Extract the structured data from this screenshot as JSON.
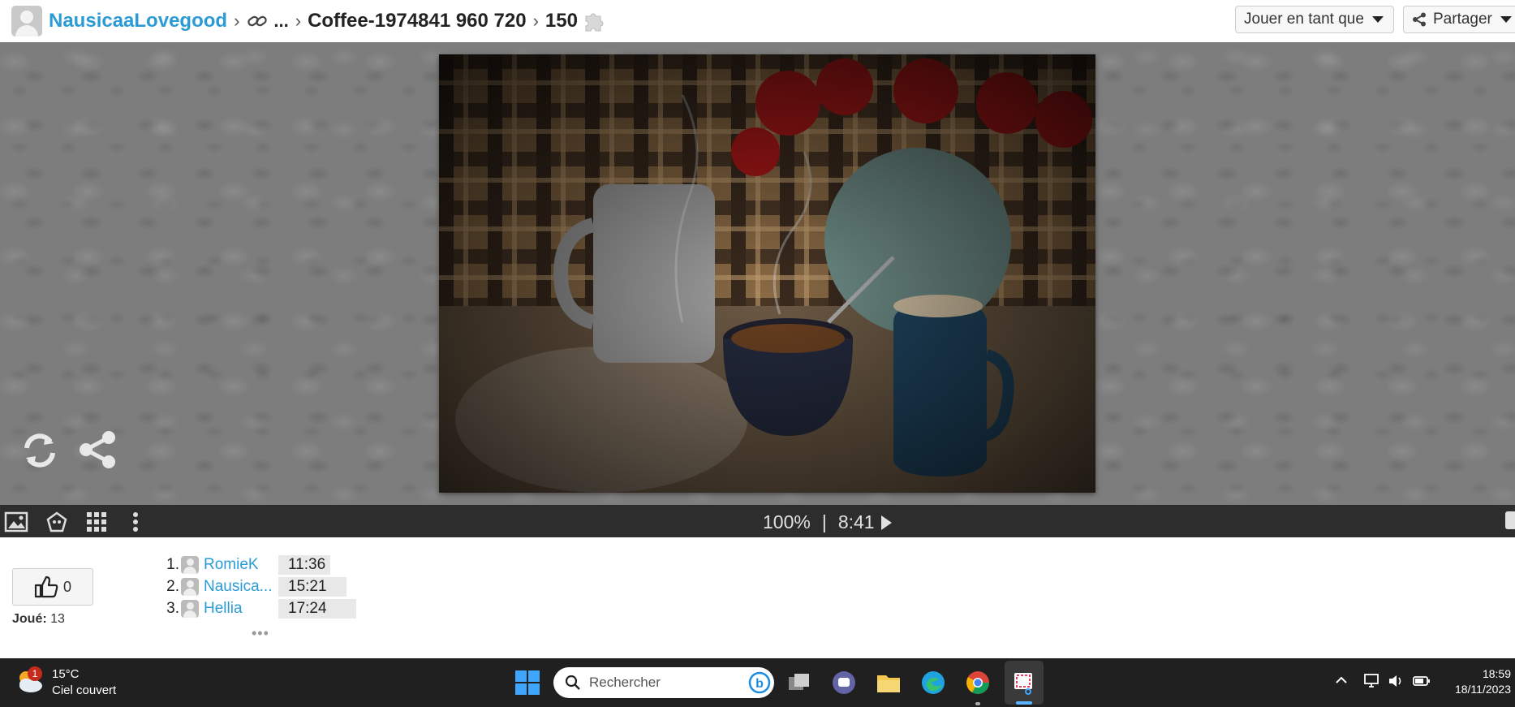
{
  "header": {
    "user_name": "NausicaaLovegood",
    "ellipsis": "...",
    "puzzle_title": "Coffee-1974841 960 720",
    "piece_count": "150",
    "play_as_label": "Jouer en tant que",
    "share_label": "Partager"
  },
  "controlbar": {
    "zoom": "100%",
    "divider": "|",
    "timer": "8:41"
  },
  "stats": {
    "likes": "0",
    "played_label": "Joué:",
    "played_count": "13"
  },
  "leaderboard": [
    {
      "rank": "1.",
      "name": "RomieK",
      "time": "11:36"
    },
    {
      "rank": "2.",
      "name": "Nausica...",
      "time": "15:21"
    },
    {
      "rank": "3.",
      "name": "Hellia",
      "time": "17:24"
    }
  ],
  "more": "•••",
  "taskbar": {
    "weather_badge": "1",
    "temperature": "15°C",
    "condition": "Ciel couvert",
    "search_placeholder": "Rechercher",
    "time": "18:59",
    "date": "18/11/2023"
  },
  "colors": {
    "link": "#2b9bd6",
    "controlbar_bg": "#2d2d2d",
    "taskbar_bg": "#202020",
    "stage_bg": "#7d7d7d"
  }
}
